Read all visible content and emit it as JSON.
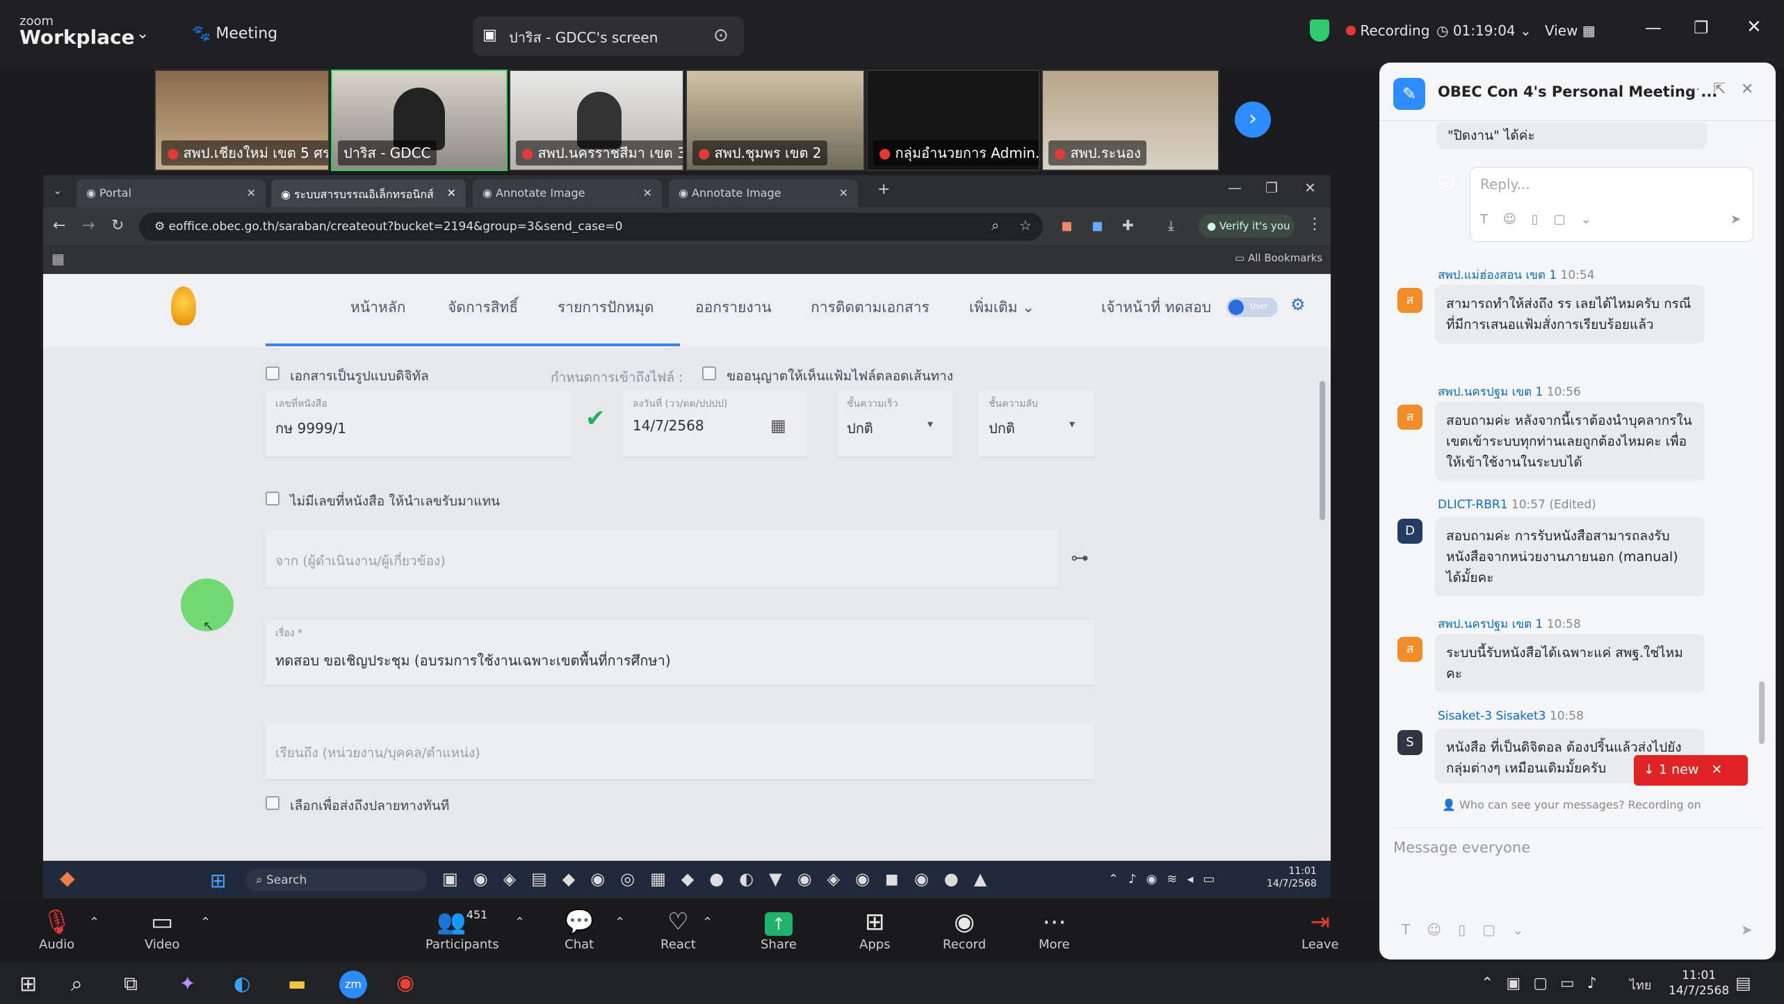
{
  "zoom": {
    "brand_small": "zoom",
    "brand_big": "Workplace",
    "meeting_label": "Meeting",
    "share_title": "ปาริส - GDCC's screen",
    "recording_label": "Recording",
    "timer": "01:19:04",
    "view_label": "View"
  },
  "thumbnails": [
    {
      "label": "สพป.เชียงใหม่ เขต 5 ศร."
    },
    {
      "label": "ปาริส - GDCC"
    },
    {
      "label": "สพป.นครราชสีมา เขต 3"
    },
    {
      "label": "สพป.ชุมพร เขต 2"
    },
    {
      "label": "กลุ่มอำนวยการ Admin..."
    },
    {
      "label": "สพป.ระนอง"
    }
  ],
  "browser": {
    "tabs": [
      "Portal",
      "ระบบสารบรรณอิเล็กทรอนิกส์",
      "Annotate Image",
      "Annotate Image"
    ],
    "url": "eoffice.obec.go.th/saraban/createout?bucket=2194&group=3&send_case=0",
    "verify_label": "Verify it's you",
    "all_bookmarks": "All Bookmarks"
  },
  "site": {
    "nav": [
      "หน้าหลัก",
      "จัดการสิทธิ์",
      "รายการปักหมุด",
      "ออกรายงาน",
      "การติดตามเอกสาร",
      "เพิ่มเติม"
    ],
    "user_label": "เจ้าหน้าที่ ทดสอบ",
    "toggle_label": "User"
  },
  "form": {
    "digital_doc_label": "เอกสารเป็นรูปแบบดิจิทัล",
    "access_label": "กำหนดการเข้าถึงไฟล์ :",
    "allow_view_label": "ขออนุญาตให้เห็นแฟ้มไฟล์ตลอดเส้นทาง",
    "doc_no_label": "เลขที่หนังสือ",
    "doc_no_value": "กษ 9999/1",
    "date_label": "ลงวันที่ (วว/ดด/ปปปป)",
    "date_value": "14/7/2568",
    "speed_label": "ชั้นความเร็ว",
    "speed_value": "ปกติ",
    "secret_label": "ชั้นความลับ",
    "secret_value": "ปกติ",
    "no_number_label": "ไม่มีเลขที่หนังสือ ให้นำเลขรับมาแทน",
    "from_placeholder": "จาก (ผู้ดำเนินงาน/ผู้เกี่ยวข้อง)",
    "subject_label": "เรื่อง *",
    "subject_value": "ทดสอบ ขอเชิญประชุม (อบรมการใช้งานเฉพาะเขตพื้นที่การศึกษา)",
    "to_placeholder": "เรียนถึง (หน่วยงาน/บุคคล/ตำแหน่ง)",
    "send_direct_label": "เลือกเพื่อส่งถึงปลายทางทันที"
  },
  "remote_taskbar": {
    "search_label": "Search",
    "time": "11:01",
    "date": "14/7/2568"
  },
  "controls": {
    "audio": "Audio",
    "video": "Video",
    "participants": "Participants",
    "participants_count": "451",
    "chat": "Chat",
    "react": "React",
    "share": "Share",
    "apps": "Apps",
    "record": "Record",
    "more": "More",
    "leave": "Leave"
  },
  "chat": {
    "title": "OBEC Con 4's Personal Meeting ...",
    "prev_text": "\"ปิดงาน\" ได้ค่ะ",
    "reply_placeholder": "Reply...",
    "messages": [
      {
        "sender": "สพป.แม่ฮ่องสอน เขต 1",
        "time": "10:54",
        "avatar": "ส",
        "text": "สามารถทำให้ส่งถึง รร เลยได้ไหมครับ กรณีที่มีการเสนอแฟ้มสั่งการเรียบร้อยแล้ว"
      },
      {
        "sender": "สพป.นครปฐม เขต 1",
        "time": "10:56",
        "avatar": "ส",
        "text": "สอบถามค่ะ หลังจากนี้เราต้องนำบุคลากรในเขตเข้าระบบทุกท่านเลยถูกต้องไหมคะ เพื่อให้เข้าใช้งานในระบบได้"
      },
      {
        "sender": "DLICT-RBR1",
        "time": "10:57 (Edited)",
        "avatar": "D",
        "text": "สอบถามค่ะ การรับหนังสือสามารถลงรับหนังสือจากหน่วยงานภายนอก (manual) ได้มั้ยคะ"
      },
      {
        "sender": "สพป.นครปฐม เขต 1",
        "time": "10:58",
        "avatar": "ส",
        "text": "ระบบนี้รับหนังสือได้เฉพาะแค่ สพฐ.ใช่ไหมคะ"
      },
      {
        "sender": "Sisaket-3 Sisaket3",
        "time": "10:58",
        "avatar": "S",
        "text": "หนังสือ ที่เป็นดิจิตอล ต้องปริ้นแล้วส่งไปยังกลุ่มต่างๆ เหมือนเดิมมั้ยครับ"
      }
    ],
    "new_badge": "1 new",
    "privacy_note": "Who can see your messages? Recording on",
    "input_placeholder": "Message everyone"
  },
  "windows": {
    "time": "11:01",
    "date": "14/7/2568"
  },
  "colors": {
    "accent": "#2d8cff",
    "recording": "#e53935",
    "share_green": "#21b26b",
    "cursor_highlight": "#5cd65c"
  }
}
